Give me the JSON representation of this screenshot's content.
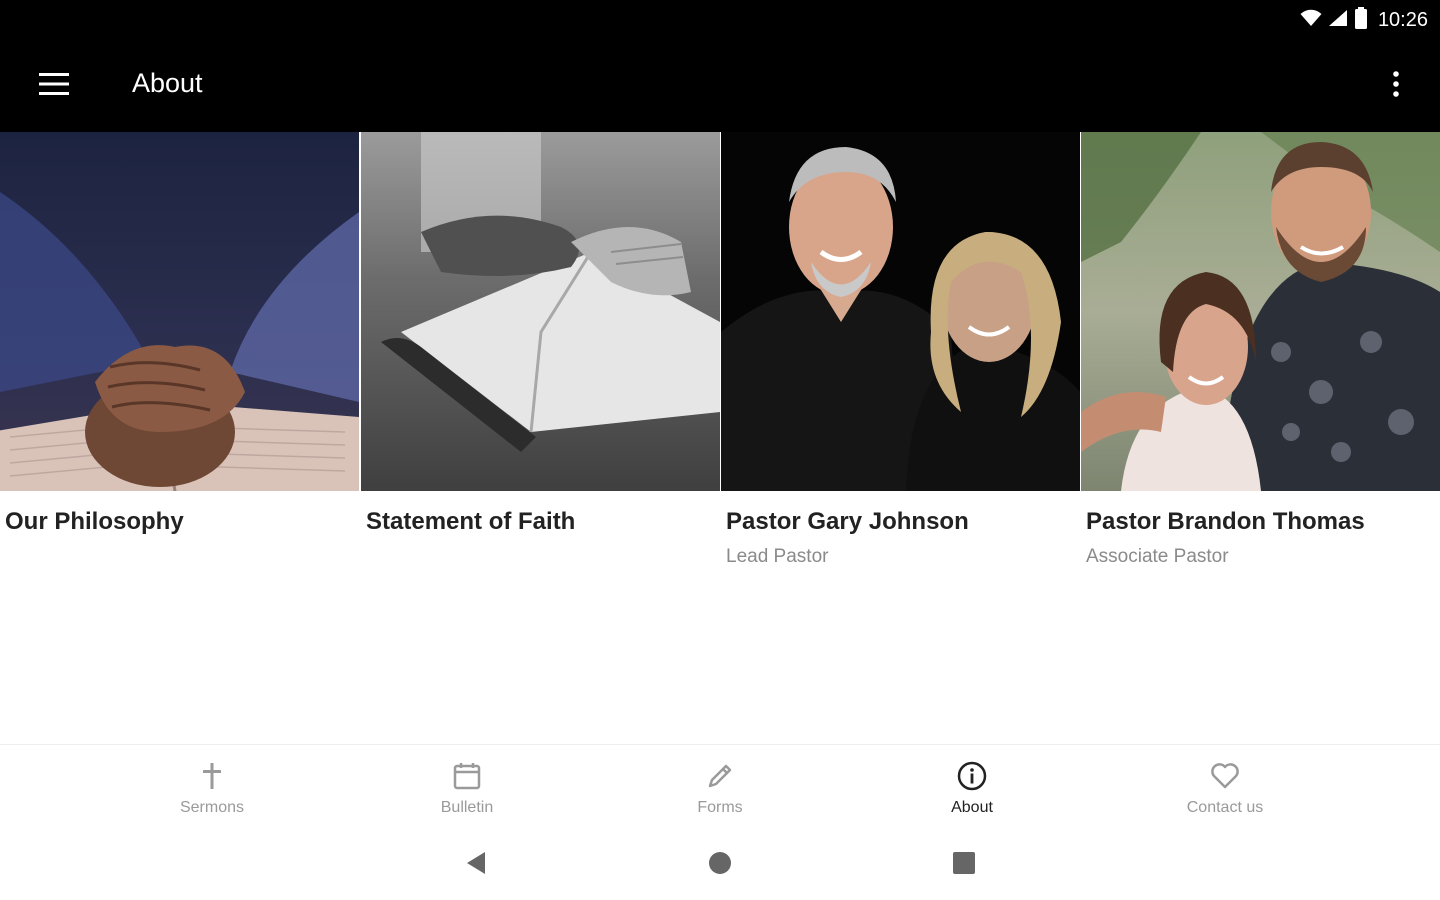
{
  "status_bar": {
    "time": "10:26",
    "icons": [
      "wifi-icon",
      "cellular-signal-icon",
      "battery-icon"
    ]
  },
  "app_bar": {
    "title": "About",
    "left_icon": "hamburger-menu-icon",
    "right_icon": "overflow-menu-icon"
  },
  "cards": [
    {
      "title": "Our Philosophy",
      "subtitle": "",
      "image": "praying-hands-on-bible-photo"
    },
    {
      "title": "Statement of Faith",
      "subtitle": "",
      "image": "hand-on-open-bible-photo"
    },
    {
      "title": "Pastor Gary Johnson",
      "subtitle": "Lead Pastor",
      "image": "pastor-couple-portrait-photo"
    },
    {
      "title": "Pastor Brandon Thomas",
      "subtitle": "Associate Pastor",
      "image": "associate-pastor-couple-photo"
    }
  ],
  "bottom_nav": {
    "items": [
      {
        "label": "Sermons",
        "icon": "cross-icon"
      },
      {
        "label": "Bulletin",
        "icon": "calendar-icon"
      },
      {
        "label": "Forms",
        "icon": "pencil-icon"
      },
      {
        "label": "About",
        "icon": "info-icon"
      },
      {
        "label": "Contact us",
        "icon": "heart-icon"
      }
    ],
    "active": "About"
  },
  "system_nav": {
    "buttons": [
      "back-icon",
      "home-icon",
      "recents-icon"
    ]
  },
  "colors": {
    "app_bar": "#000000",
    "background": "#ffffff",
    "title_text": "#222222",
    "subtitle_text": "#8a8a8a",
    "nav_inactive": "#9a9a9a",
    "nav_active": "#222222"
  }
}
